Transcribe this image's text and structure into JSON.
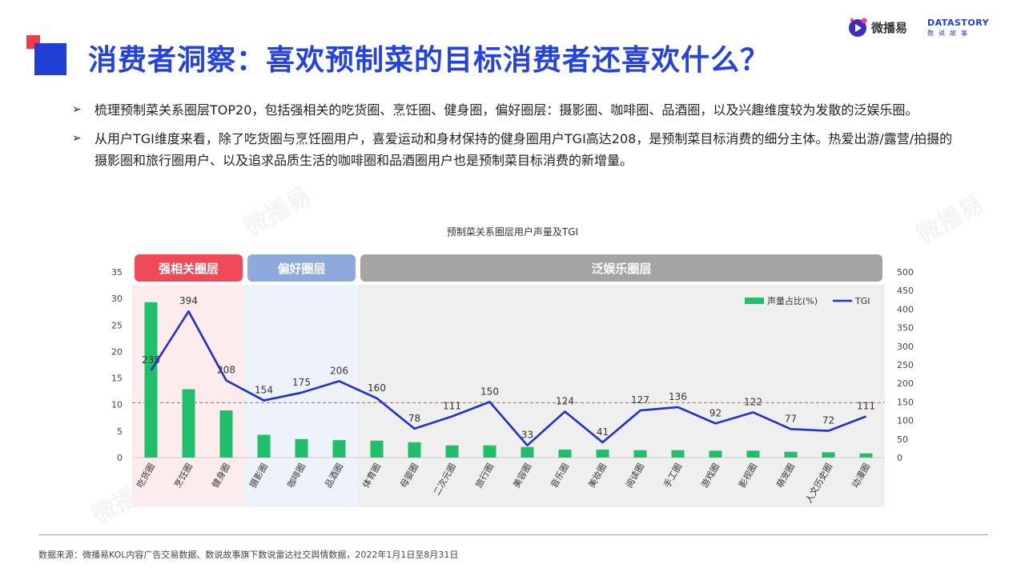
{
  "header": {
    "title": "消费者洞察：喜欢预制菜的目标消费者还喜欢什么？",
    "brand_weibo": "微播易",
    "brand_ds_name": "DATASTORY",
    "brand_ds_sub": "数说故事"
  },
  "bullets": [
    "梳理预制菜关系圈层TOP20，包括强相关的吃货圈、烹饪圈、健身圈，偏好圈层：摄影圈、咖啡圈、品酒圈，以及兴趣维度较为发散的泛娱乐圈。",
    "从用户TGI维度来看，除了吃货圈与烹饪圈用户，喜爱运动和身材保持的健身圈用户TGI高达208，是预制菜目标消费的细分主体。热爱出游/露营/拍摄的摄影圈和旅行圈用户、以及追求品质生活的咖啡圈和品酒圈用户也是预制菜目标消费的新增量。"
  ],
  "bullet_marker": "➢",
  "footer": {
    "source": "数据来源：微播易KOL内容广告交易数据、数说故事旗下数说雷达社交舆情数据，2022年1月1日至8月31日"
  },
  "watermark": "微播易",
  "chart_data": {
    "type": "bar+line",
    "title": "预制菜关系圈层用户声量及TGI",
    "categories": [
      "吃货圈",
      "烹饪圈",
      "健身圈",
      "摄影圈",
      "咖啡圈",
      "品酒圈",
      "体育圈",
      "母婴圈",
      "二次元圈",
      "旅行圈",
      "美容圈",
      "音乐圈",
      "美妆圈",
      "阅读圈",
      "手工圈",
      "游戏圈",
      "影视圈",
      "萌宠圈",
      "人文历史圈",
      "动漫圈"
    ],
    "series": [
      {
        "name": "声量占比(%)",
        "type": "bar",
        "axis": "left",
        "color": "#1fbf6b",
        "values": [
          29.3,
          12.9,
          8.9,
          4.3,
          3.5,
          3.3,
          3.2,
          2.9,
          2.3,
          2.3,
          2.0,
          1.5,
          1.5,
          1.4,
          1.4,
          1.3,
          1.3,
          1.1,
          1.0,
          0.8
        ]
      },
      {
        "name": "TGI",
        "type": "line",
        "axis": "right",
        "color": "#1f2fd0",
        "values": [
          235,
          394,
          208,
          154,
          175,
          206,
          160,
          78,
          111,
          150,
          33,
          124,
          41,
          127,
          136,
          92,
          122,
          77,
          72,
          111
        ],
        "labels": [
          "235",
          "394",
          "208",
          "154",
          "175",
          "206",
          "160",
          "78",
          "111",
          "150",
          "33",
          "124",
          "41",
          "127",
          "136",
          "92",
          "122",
          "77",
          "72",
          "111"
        ]
      }
    ],
    "y_left": {
      "min": 0,
      "max": 35,
      "ticks": [
        0,
        5,
        10,
        15,
        20,
        25,
        30,
        35
      ]
    },
    "y_right": {
      "min": 0,
      "max": 500,
      "ticks": [
        0,
        50,
        100,
        150,
        200,
        250,
        300,
        350,
        400,
        450,
        500
      ]
    },
    "reference_line": {
      "axis": "right",
      "value": 148,
      "color": "#e84a55"
    },
    "groups": [
      {
        "label": "强相关圈层",
        "start": 0,
        "end": 2,
        "header_color": "#ee4a58",
        "band_color": "#fdecee"
      },
      {
        "label": "偏好圈层",
        "start": 3,
        "end": 5,
        "header_color": "#8ea9dc",
        "band_color": "#eef2fb"
      },
      {
        "label": "泛娱乐圈层",
        "start": 6,
        "end": 19,
        "header_color": "#a4a4a4",
        "band_color": "#efefef"
      }
    ],
    "legend_position": "top-right",
    "grid": false
  }
}
